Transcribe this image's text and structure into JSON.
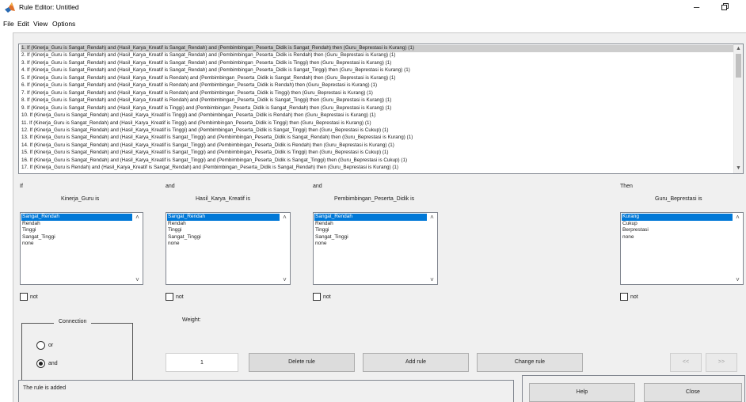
{
  "window": {
    "title": "Rule Editor: Untitled",
    "minimize_glyph": "–"
  },
  "menu": [
    "File",
    "Edit",
    "View",
    "Options"
  ],
  "rules": [
    "1. If (Kinerja_Guru is Sangat_Rendah) and (Hasil_Karya_Kreatif is Sangat_Rendah) and (Pembimbingan_Peserta_Didik is Sangat_Rendah) then (Guru_Beprestasi is Kurang) (1)",
    "2. If (Kinerja_Guru is Sangat_Rendah) and (Hasil_Karya_Kreatif is Sangat_Rendah) and (Pembimbingan_Peserta_Didik is Rendah) then (Guru_Beprestasi is Kurang) (1)",
    "3. If (Kinerja_Guru is Sangat_Rendah) and (Hasil_Karya_Kreatif is Sangat_Rendah) and (Pembimbingan_Peserta_Didik is Tinggi) then (Guru_Beprestasi is Kurang) (1)",
    "4. If (Kinerja_Guru is Sangat_Rendah) and (Hasil_Karya_Kreatif is Sangat_Rendah) and (Pembimbingan_Peserta_Didik is Sangat_Tinggi) then (Guru_Beprestasi is Kurang) (1)",
    "5. If (Kinerja_Guru is Sangat_Rendah) and (Hasil_Karya_Kreatif is Rendah) and (Pembimbingan_Peserta_Didik is Sangat_Rendah) then (Guru_Beprestasi is Kurang) (1)",
    "6. If (Kinerja_Guru is Sangat_Rendah) and (Hasil_Karya_Kreatif is Rendah) and (Pembimbingan_Peserta_Didik is Rendah) then (Guru_Beprestasi is Kurang) (1)",
    "7. If (Kinerja_Guru is Sangat_Rendah) and (Hasil_Karya_Kreatif is Rendah) and (Pembimbingan_Peserta_Didik is Tinggi) then (Guru_Beprestasi is Kurang) (1)",
    "8. If (Kinerja_Guru is Sangat_Rendah) and (Hasil_Karya_Kreatif is Rendah) and (Pembimbingan_Peserta_Didik is Sangat_Tinggi) then (Guru_Beprestasi is Kurang) (1)",
    "9. If (Kinerja_Guru is Sangat_Rendah) and (Hasil_Karya_Kreatif is Tinggi) and (Pembimbingan_Peserta_Didik is Sangat_Rendah) then (Guru_Beprestasi is Kurang) (1)",
    "10. If (Kinerja_Guru is Sangat_Rendah) and (Hasil_Karya_Kreatif is Tinggi) and (Pembimbingan_Peserta_Didik is Rendah) then (Guru_Beprestasi is Kurang) (1)",
    "11. If (Kinerja_Guru is Sangat_Rendah) and (Hasil_Karya_Kreatif is Tinggi) and (Pembimbingan_Peserta_Didik is Tinggi) then (Guru_Beprestasi is Kurang) (1)",
    "12. If (Kinerja_Guru is Sangat_Rendah) and (Hasil_Karya_Kreatif is Tinggi) and (Pembimbingan_Peserta_Didik is Sangat_Tinggi) then (Guru_Beprestasi is Cukup) (1)",
    "13. If (Kinerja_Guru is Sangat_Rendah) and (Hasil_Karya_Kreatif is Sangat_Tinggi) and (Pembimbingan_Peserta_Didik is Sangat_Rendah) then (Guru_Beprestasi is Kurang) (1)",
    "14. If (Kinerja_Guru is Sangat_Rendah) and (Hasil_Karya_Kreatif is Sangat_Tinggi) and (Pembimbingan_Peserta_Didik is Rendah) then (Guru_Beprestasi is Kurang) (1)",
    "15. If (Kinerja_Guru is Sangat_Rendah) and (Hasil_Karya_Kreatif is Sangat_Tinggi) and (Pembimbingan_Peserta_Didik is Tinggi) then (Guru_Beprestasi is Cukup) (1)",
    "16. If (Kinerja_Guru is Sangat_Rendah) and (Hasil_Karya_Kreatif is Sangat_Tinggi) and (Pembimbingan_Peserta_Didik is Sangat_Tinggi) then (Guru_Beprestasi is Cukup) (1)",
    "17. If (Kinerja_Guru is Rendah) and (Hasil_Karya_Kreatif is Sangat_Rendah) and (Pembimbingan_Peserta_Didik is Sangat_Rendah) then (Guru_Beprestasi is Kurang) (1)"
  ],
  "selected_rule_index": 0,
  "inputs": [
    {
      "connector": "If",
      "variable": "Kinerja_Guru is",
      "options": [
        "Sangat_Rendah",
        "Rendah",
        "Tinggi",
        "Sangat_Tinggi",
        "none"
      ],
      "selected": 0,
      "not_label": "not"
    },
    {
      "connector": "and",
      "variable": "Hasil_Karya_Kreatif is",
      "options": [
        "Sangat_Rendah",
        "Rendah",
        "Tinggi",
        "Sangat_Tinggi",
        "none"
      ],
      "selected": 0,
      "not_label": "not"
    },
    {
      "connector": "and",
      "variable": "Pembimbingan_Peserta_Didik is",
      "options": [
        "Sangat_Rendah",
        "Rendah",
        "Tinggi",
        "Sangat_Tinggi",
        "none"
      ],
      "selected": 0,
      "not_label": "not"
    }
  ],
  "output": {
    "connector": "Then",
    "variable": "Guru_Beprestasi is",
    "options": [
      "Kurang",
      "Cukup",
      "Berprestasi",
      "none"
    ],
    "selected": 0,
    "not_label": "not"
  },
  "connection": {
    "title": "Connection",
    "options": [
      "or",
      "and"
    ],
    "selected": "and"
  },
  "weight": {
    "label": "Weight:",
    "value": "1"
  },
  "buttons": {
    "delete": "Delete rule",
    "add": "Add rule",
    "change": "Change rule",
    "prev": "<<",
    "next": ">>",
    "help": "Help",
    "close": "Close"
  },
  "status": "The rule is added",
  "colors": {
    "selection": "#0078d7",
    "rule_selection": "#cdcdcd",
    "panel": "#f0f0f0"
  }
}
